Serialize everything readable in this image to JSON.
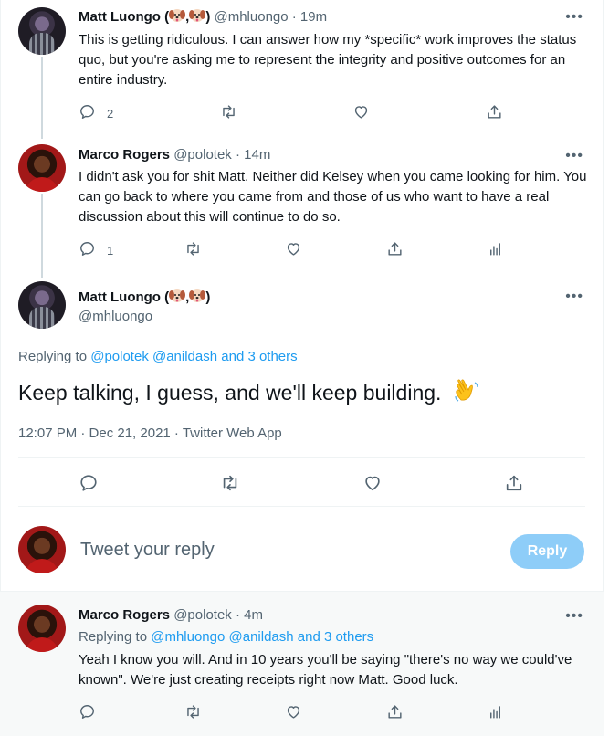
{
  "tweet1": {
    "name": "Matt Luongo (",
    "name_end": ")",
    "handle": "@mhluongo",
    "time": "· 19m",
    "text": "This is getting ridiculous. I can answer how my *specific* work improves the status quo, but you're asking me to represent the integrity and positive outcomes for an entire industry.",
    "reply_count": "2"
  },
  "tweet2": {
    "name": "Marco Rogers",
    "handle": "@polotek",
    "time": "· 14m",
    "text": "I didn't ask you for shit Matt. Neither did Kelsey when you came looking for him. You can go back to where you came from and those of us who want to have a real discussion about this will continue to do so.",
    "reply_count": "1"
  },
  "main_tweet": {
    "name": "Matt Luongo (",
    "name_end": ")",
    "handle": "@mhluongo",
    "replying_prefix": "Replying to",
    "replying_targets": "@polotek @anildash and 3 others",
    "text": "Keep talking, I guess, and we'll keep building.",
    "meta": "12:07 PM · Dec 21, 2021 · Twitter Web App"
  },
  "composer": {
    "placeholder": "Tweet your reply",
    "reply_label": "Reply"
  },
  "tweet3": {
    "name": "Marco Rogers",
    "handle": "@polotek",
    "time": "· 4m",
    "replying_prefix": "Replying to",
    "replying_targets": "@mhluongo @anildash and 3 others",
    "text": "Yeah I know you will. And in 10 years you'll be saying \"there's no way we could've known\". We're just creating receipts right now Matt. Good luck."
  },
  "more_glyph": "•••",
  "colors": {
    "accent": "#1d9bf0",
    "muted": "#536471",
    "reply_button": "#8ecdf8",
    "thread_line": "#cfd9de"
  }
}
